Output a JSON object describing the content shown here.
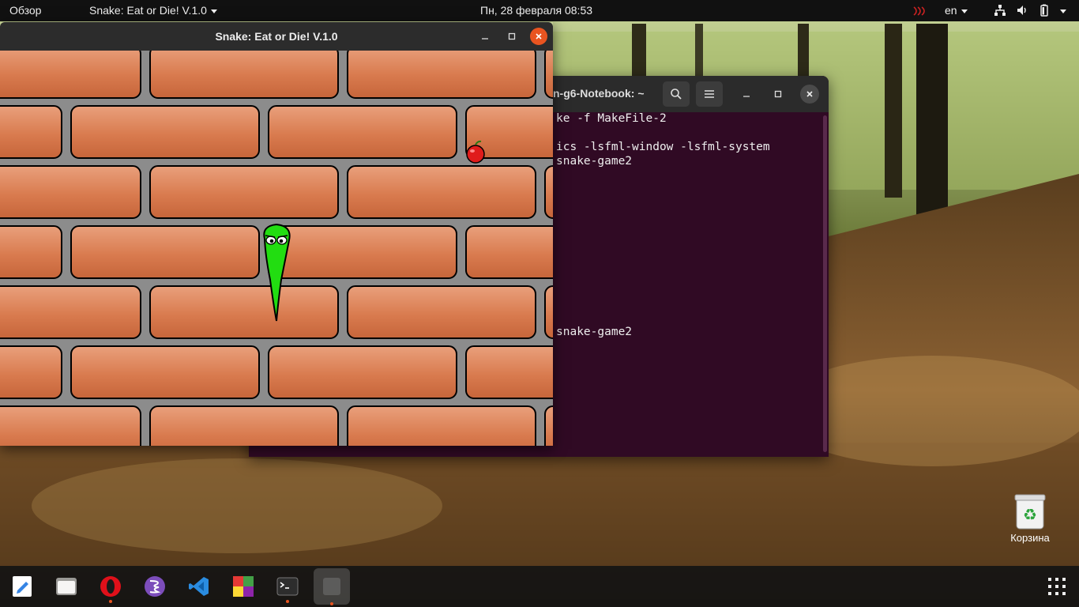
{
  "topbar": {
    "activities": "Обзор",
    "app_menu": "Snake: Eat or Die! V.1.0",
    "datetime": "Пн, 28 февраля  08:53",
    "language": "en"
  },
  "terminal": {
    "title": "n-g6-Notebook: ~",
    "lines": [
      "ke -f MakeFile-2",
      "",
      "ics -lsfml-window -lsfml-system",
      "snake-game2",
      "",
      "",
      "",
      "",
      "",
      "",
      "",
      "",
      "snake-game2"
    ],
    "colors": {
      "background": "#300a24",
      "header": "#2b2b2b"
    }
  },
  "game": {
    "title": "Snake: Eat or Die! V.1.0",
    "colors": {
      "close": "#e95420",
      "snake": "#22dd11",
      "apple": "#e01b1b",
      "brick": "#d97b4f",
      "mortar": "#8c8c8c"
    }
  },
  "desktop": {
    "trash_label": "Корзина"
  },
  "dock": {
    "items": [
      {
        "icon": "text-editor-icon",
        "running": false
      },
      {
        "icon": "files-icon",
        "running": false
      },
      {
        "icon": "opera-icon",
        "running": true
      },
      {
        "icon": "emacs-icon",
        "running": false
      },
      {
        "icon": "vscode-icon",
        "running": false
      },
      {
        "icon": "game-app-icon",
        "running": false
      },
      {
        "icon": "terminal-icon",
        "running": true
      },
      {
        "icon": "snake-game-icon",
        "running": true
      }
    ]
  }
}
